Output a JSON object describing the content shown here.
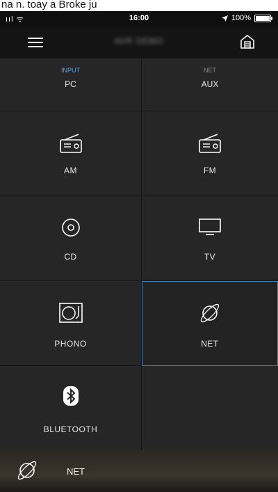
{
  "caption": "na n. toay a Broke ju",
  "status": {
    "signal": "ııl ᯤ",
    "time": "16:00",
    "battery_label": "100%",
    "location_icon": "location-arrow-icon"
  },
  "header": {
    "device_name": "AVR DEMO",
    "menu_icon": "hamburger-icon",
    "home_icon": "home-icon"
  },
  "top_row": [
    {
      "tag": "INPUT",
      "label": "PC"
    },
    {
      "tag": "NET",
      "label": "AUX"
    }
  ],
  "sources": [
    {
      "label": "AM",
      "icon": "radio-icon"
    },
    {
      "label": "FM",
      "icon": "radio-icon"
    },
    {
      "label": "CD",
      "icon": "disc-icon"
    },
    {
      "label": "TV",
      "icon": "tv-icon"
    },
    {
      "label": "PHONO",
      "icon": "turntable-icon"
    },
    {
      "label": "NET",
      "icon": "globe-icon",
      "selected": true
    },
    {
      "label": "BLUETOOTH",
      "icon": "bluetooth-icon"
    }
  ],
  "now_playing": {
    "source": "NET",
    "icon": "globe-icon"
  },
  "colors": {
    "accent": "#4ea6e6",
    "selected_border": "#4a7fb0",
    "tile_bg": "#262626"
  }
}
